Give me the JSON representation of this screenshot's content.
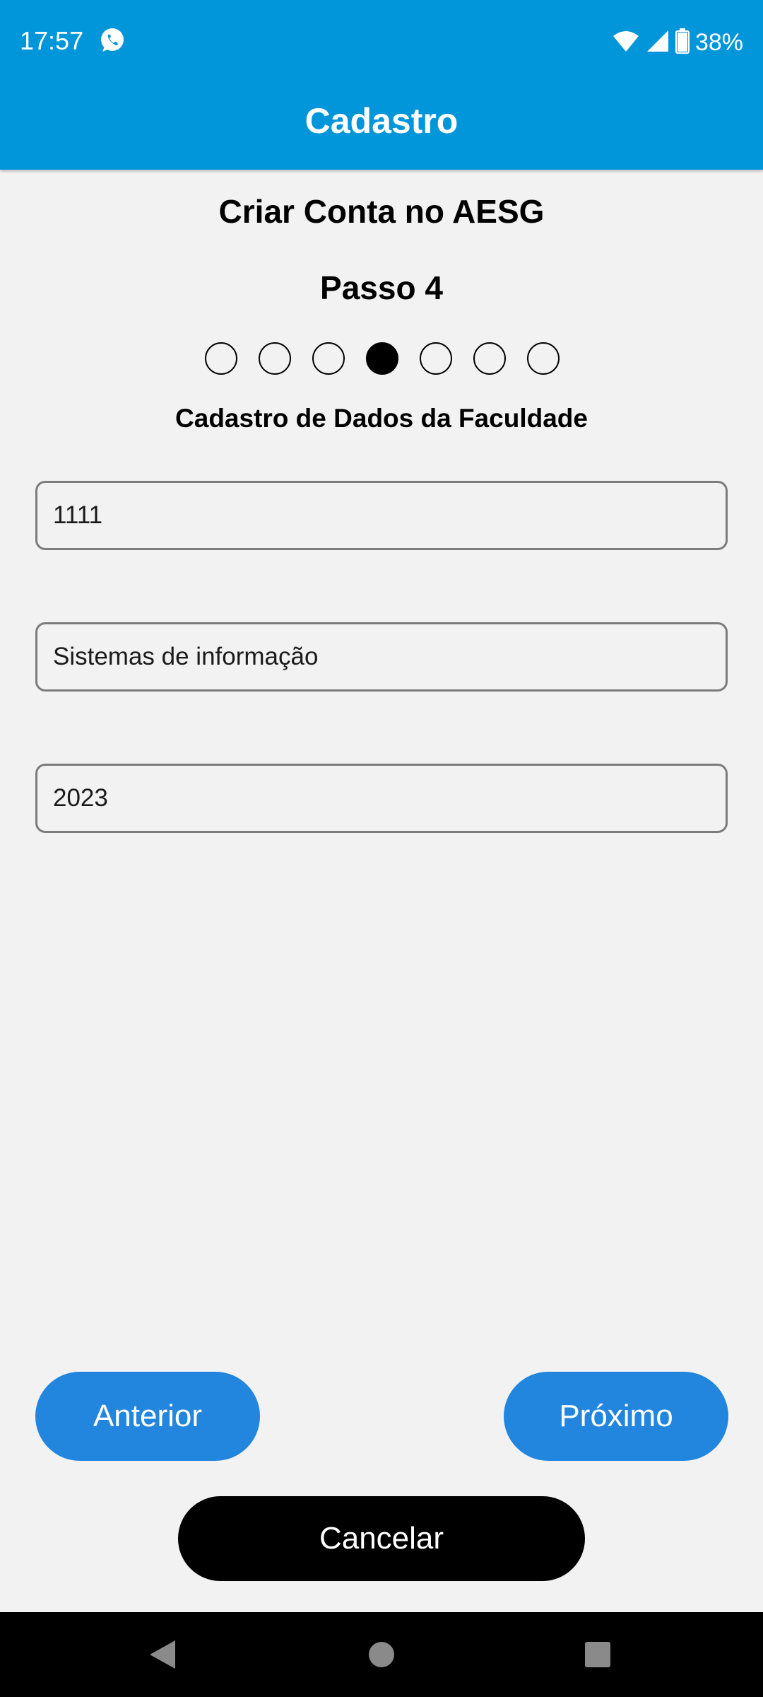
{
  "status_bar": {
    "time": "17:57",
    "battery": "38%",
    "icons": [
      "whatsapp-icon",
      "wifi-icon",
      "signal-icon",
      "battery-icon"
    ]
  },
  "header": {
    "title": "Cadastro"
  },
  "main": {
    "title": "Criar Conta no AESG",
    "step_label": "Passo 4",
    "steps_total": 7,
    "step_current": 4,
    "section_title": "Cadastro de Dados da Faculdade",
    "fields": [
      {
        "value": "1111"
      },
      {
        "value": "Sistemas de informação"
      },
      {
        "value": "2023"
      }
    ]
  },
  "buttons": {
    "previous": "Anterior",
    "next": "Próximo",
    "cancel": "Cancelar"
  },
  "nav": {
    "icons": [
      "back-icon",
      "home-icon",
      "recents-icon"
    ]
  },
  "colors": {
    "header": "#0096d9",
    "primary_button": "#2286de",
    "cancel_button": "#000000",
    "background": "#f2f2f2"
  }
}
